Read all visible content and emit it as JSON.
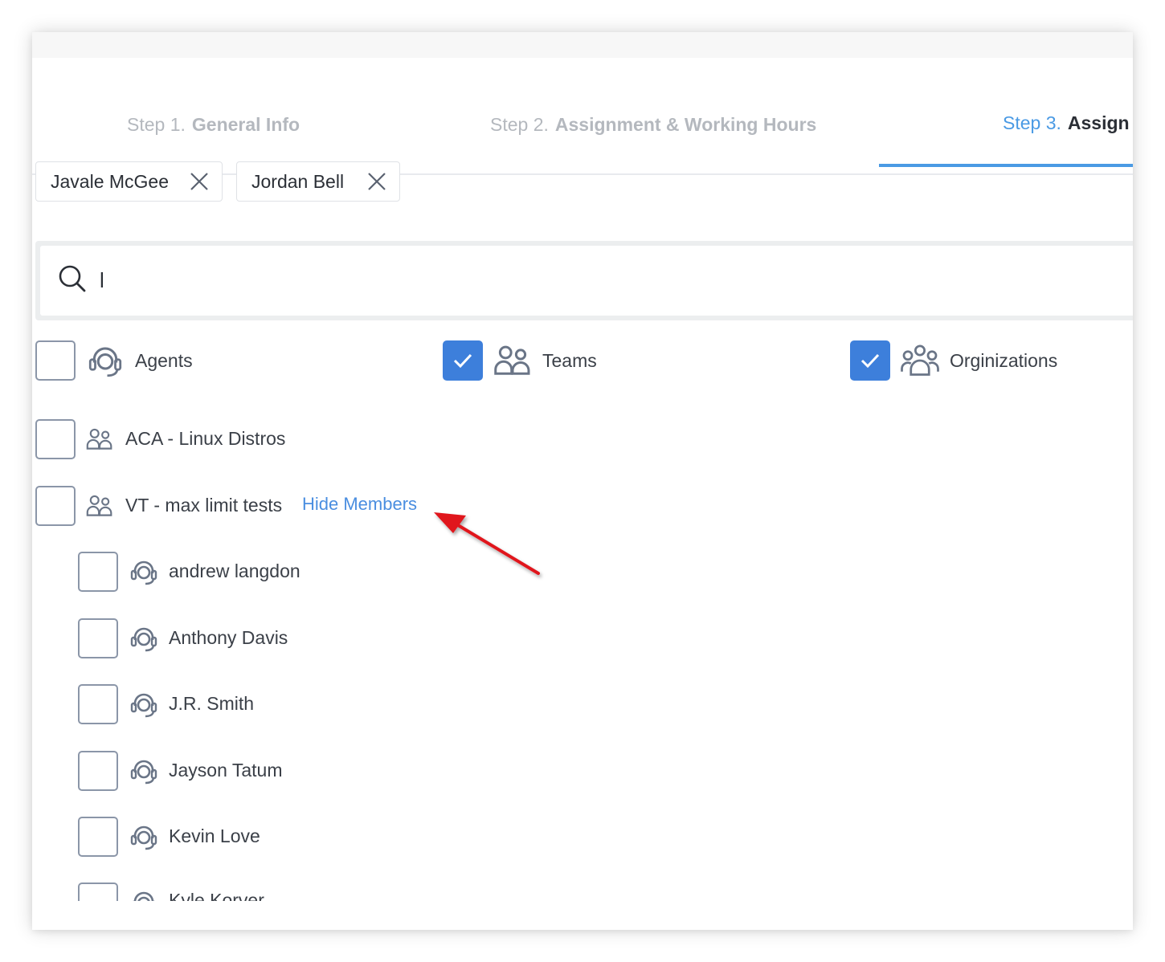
{
  "steps": [
    {
      "num": "Step 1.",
      "label": "General Info"
    },
    {
      "num": "Step 2.",
      "label": "Assignment & Working Hours"
    },
    {
      "num": "Step 3.",
      "label": "Assign"
    }
  ],
  "chips": [
    {
      "label": "Javale McGee"
    },
    {
      "label": "Jordan Bell"
    }
  ],
  "search": {
    "value": "l",
    "placeholder": ""
  },
  "filters": [
    {
      "label": "Agents",
      "checked": false,
      "icon": "headset-icon"
    },
    {
      "label": "Teams",
      "checked": true,
      "icon": "team-icon"
    },
    {
      "label": "Orginizations",
      "checked": true,
      "icon": "organization-icon"
    }
  ],
  "teams": [
    {
      "label": "ACA - Linux Distros",
      "checked": false
    },
    {
      "label": "VT - max limit tests",
      "checked": false,
      "toggle_label": "Hide Members"
    }
  ],
  "members": [
    {
      "label": "andrew langdon",
      "checked": false
    },
    {
      "label": "Anthony Davis",
      "checked": false
    },
    {
      "label": "J.R. Smith",
      "checked": false
    },
    {
      "label": "Jayson Tatum",
      "checked": false
    },
    {
      "label": "Kevin Love",
      "checked": false
    },
    {
      "label": "Kyle Korver",
      "checked": false
    }
  ],
  "colors": {
    "accent": "#4a9ae4",
    "checkbox_checked": "#3d7fdb",
    "annotation_arrow": "#e0161e"
  }
}
